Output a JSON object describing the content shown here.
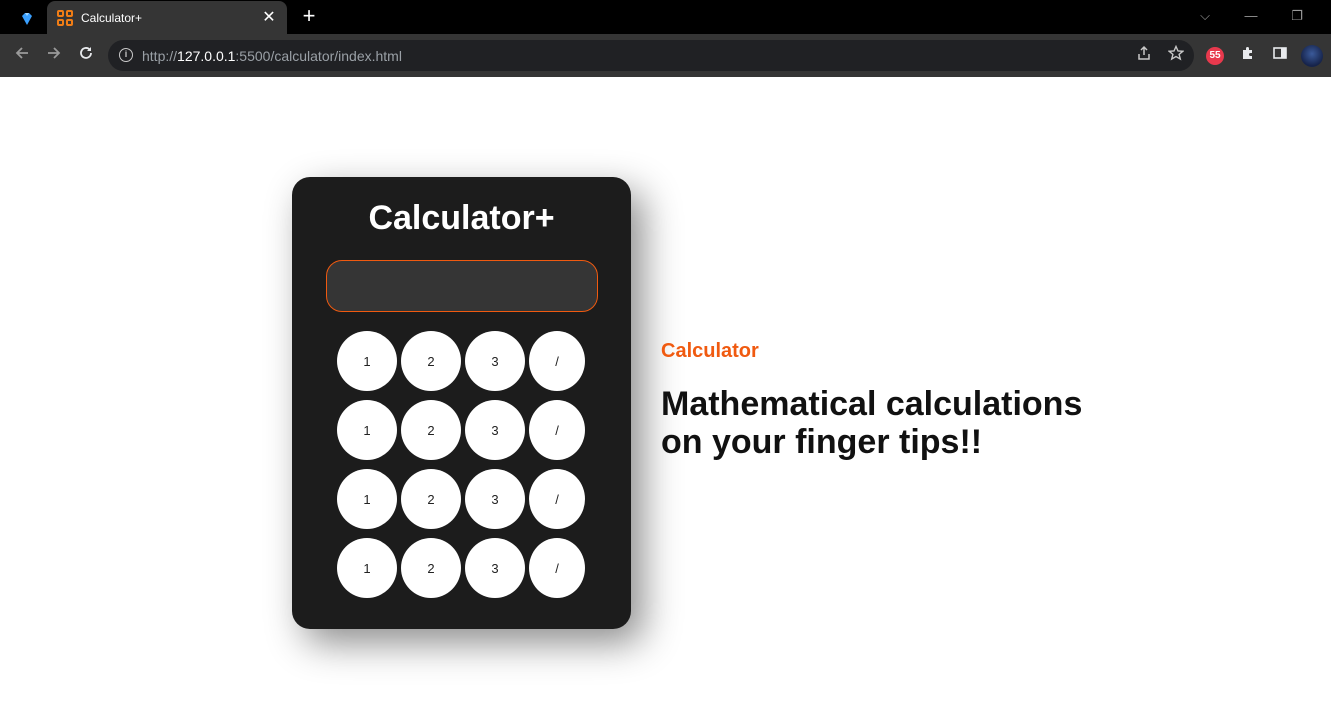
{
  "browser": {
    "tab_title": "Calculator+",
    "tab_close": "✕",
    "new_tab": "+",
    "url_scheme": "http://",
    "url_host": "127.0.0.1",
    "url_path": ":5500/calculator/index.html",
    "window_controls": {
      "dropdown": "⌵",
      "minimize": "—",
      "restore": "❐"
    },
    "icons": [
      "diamond-icon",
      "grid-favicon",
      "back-arrow-icon",
      "forward-arrow-icon",
      "reload-icon",
      "info-icon",
      "share-icon",
      "star-icon",
      "extension-red-icon",
      "puzzle-icon",
      "sidepanel-icon",
      "profile-avatar"
    ]
  },
  "calculator": {
    "title": "Calculator+",
    "display_value": "",
    "keys": [
      [
        "1",
        "2",
        "3",
        "/"
      ],
      [
        "1",
        "2",
        "3",
        "/"
      ],
      [
        "1",
        "2",
        "3",
        "/"
      ],
      [
        "1",
        "2",
        "3",
        "/"
      ]
    ]
  },
  "hero": {
    "kicker": "Calculator",
    "heading_line1": "Mathematical calculations",
    "heading_line2": "on your finger tips!!"
  },
  "colors": {
    "accent": "#f05a10",
    "calculator_body": "#1c1c1c",
    "display_bg": "#353535",
    "key_bg": "#ffffff"
  }
}
